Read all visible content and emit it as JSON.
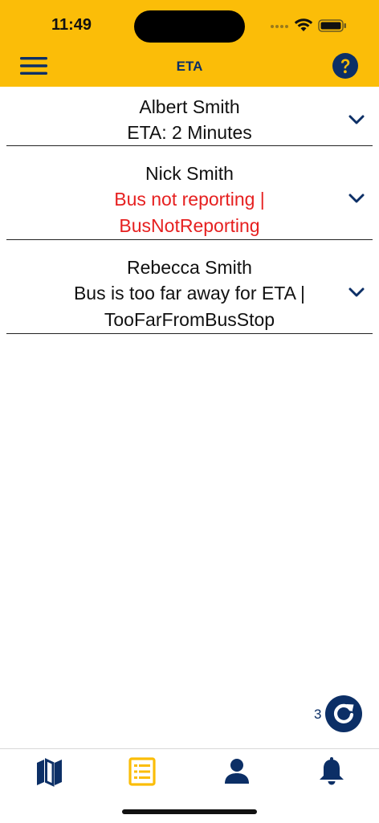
{
  "status_bar": {
    "time": "11:49"
  },
  "header": {
    "title": "ETA",
    "menu_icon": "hamburger-menu-icon",
    "help_icon": "question-circle-icon",
    "background": "#fbbd08",
    "accent": "#0c2f66"
  },
  "eta_list": [
    {
      "name": "Albert Smith",
      "status": "ETA: 2 Minutes",
      "status_lines": [
        "ETA: 2 Minutes"
      ],
      "error": false
    },
    {
      "name": "Nick Smith",
      "status_lines": [
        "Bus not reporting |",
        "BusNotReporting"
      ],
      "error": true
    },
    {
      "name": "Rebecca Smith",
      "status_lines": [
        "Bus is too far away for ETA |",
        "TooFarFromBusStop"
      ],
      "error": false
    }
  ],
  "refresh": {
    "count": "3",
    "icon": "refresh-icon"
  },
  "bottom_nav": [
    {
      "name": "map",
      "icon": "map-icon",
      "active": false
    },
    {
      "name": "list",
      "icon": "list-icon",
      "active": true
    },
    {
      "name": "profile",
      "icon": "person-icon",
      "active": false
    },
    {
      "name": "notifications",
      "icon": "bell-icon",
      "active": false
    }
  ],
  "colors": {
    "error": "#e62020",
    "active_nav": "#fbbd08",
    "nav": "#0c2f66"
  }
}
